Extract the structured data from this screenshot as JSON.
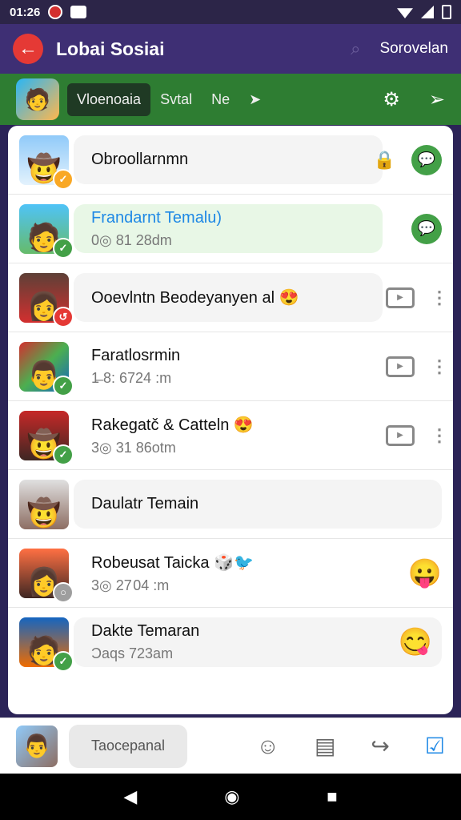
{
  "status_bar": {
    "time": "01:26"
  },
  "app_bar": {
    "title": "Lobai Sosiai",
    "right_label": "Sorovelan"
  },
  "tab_bar": {
    "tabs": [
      "Vloenoaia",
      "Svtal",
      "Ne"
    ]
  },
  "contacts": [
    {
      "name": "Obroollarnmn",
      "subtitle": "",
      "badge_color": "#f9a825"
    },
    {
      "name": "Frandarnt Temalu)",
      "subtitle": "0◎ 81 28dm",
      "badge_color": "#43a047"
    },
    {
      "name": "Ooevlntn Beodeyanyen al",
      "subtitle": "",
      "badge_color": "#e53935"
    },
    {
      "name": "Faratlosrmin",
      "subtitle": "1̶ 8: 6724 :m",
      "badge_color": "#43a047"
    },
    {
      "name": "Rakegatč & Catteln",
      "subtitle": "3◎ 31 86otm",
      "badge_color": "#43a047"
    },
    {
      "name": "Daulatr Temain",
      "subtitle": "",
      "badge_color": ""
    },
    {
      "name": "Robeusat Taicka",
      "subtitle": "3◎ 27 04 :m",
      "badge_color": "#9e9e9e"
    },
    {
      "name": "Dakte Temaran",
      "subtitle": "Ɔaqs 723am",
      "badge_color": "#43a047"
    }
  ],
  "bottom_nav": {
    "input_label": "Taocepanal"
  },
  "icons": {
    "back": "arrow-left-icon",
    "search": "search-icon",
    "gear": "gear-icon",
    "send": "send-icon",
    "chat": "chat-bubble-icon",
    "video": "video-icon",
    "more": "more-dots-icon",
    "emoji": "emoji-icon",
    "board": "board-icon",
    "share": "share-icon",
    "clipboard": "clipboard-check-icon"
  },
  "colors": {
    "app_bar": "#3e2f74",
    "tab_bar": "#2e7d32",
    "accent_red": "#e53935",
    "accent_green": "#43a047",
    "accent_blue": "#1e88e5"
  }
}
